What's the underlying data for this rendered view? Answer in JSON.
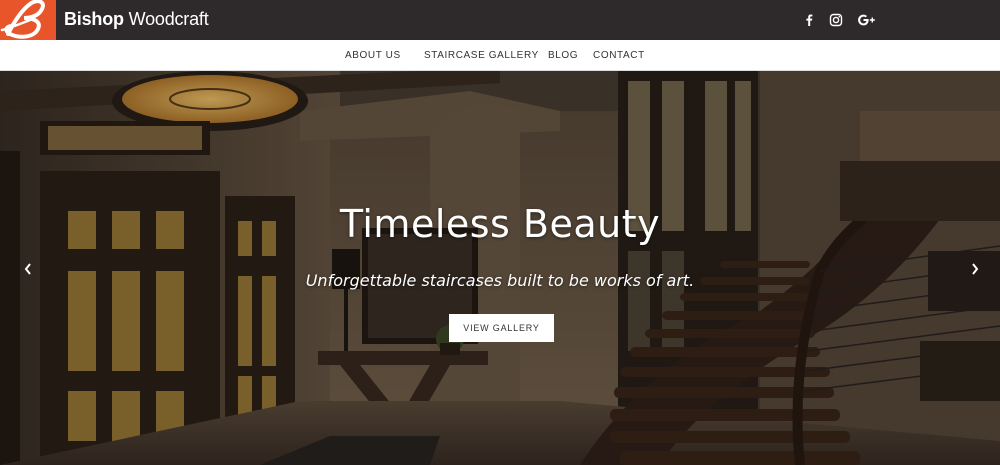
{
  "brand": {
    "name_bold": "Bishop",
    "name_light": "Woodcraft",
    "logo_letter": "B"
  },
  "colors": {
    "logo_bg": "#e8552a",
    "topbar_bg": "#2e2a2b",
    "nav_bg": "#ffffff",
    "nav_text": "#333333"
  },
  "social": [
    {
      "icon": "facebook-icon",
      "glyph": "f"
    },
    {
      "icon": "instagram-icon",
      "glyph": ""
    },
    {
      "icon": "google-plus-icon",
      "glyph": "G+"
    }
  ],
  "nav": {
    "items": [
      {
        "label": "ABOUT US"
      },
      {
        "label": "STAIRCASE GALLERY"
      },
      {
        "label": "BLOG"
      },
      {
        "label": "CONTACT"
      }
    ]
  },
  "hero": {
    "title": "Timeless Beauty",
    "subtitle": "Unforgettable staircases built to be works of art.",
    "button_label": "VIEW GALLERY",
    "prev_glyph": "‹",
    "next_glyph": "›"
  }
}
